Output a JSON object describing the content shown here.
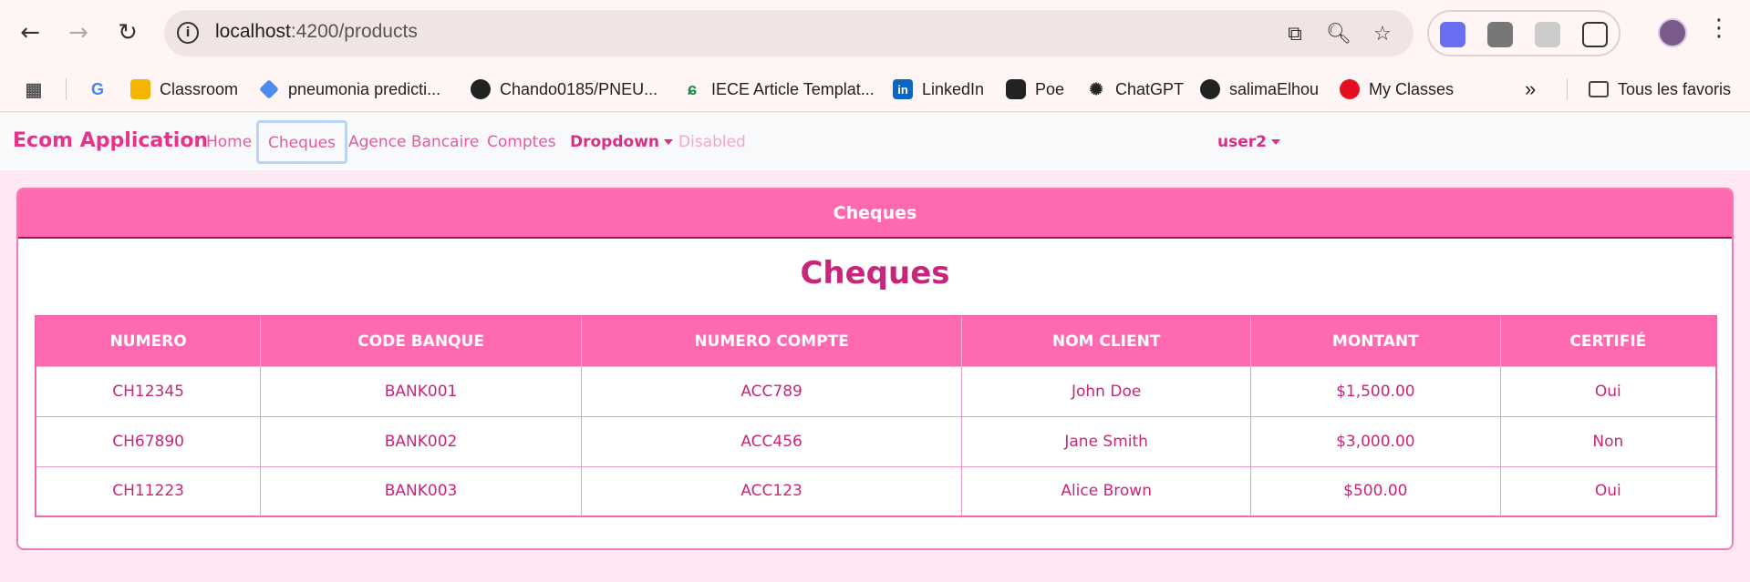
{
  "browser": {
    "url_host": "localhost",
    "url_rest": ":4200/products",
    "bookmarks": [
      {
        "label": "",
        "icon": "google-icon"
      },
      {
        "label": "Classroom",
        "icon": "classroom-icon"
      },
      {
        "label": "pneumonia predicti...",
        "icon": "layers-icon"
      },
      {
        "label": "Chando0185/PNEU...",
        "icon": "github-icon"
      },
      {
        "label": "IECE Article Templat...",
        "icon": "leaf-icon"
      },
      {
        "label": "LinkedIn",
        "icon": "linkedin-icon"
      },
      {
        "label": "Poe",
        "icon": "poe-icon"
      },
      {
        "label": "ChatGPT",
        "icon": "chatgpt-icon"
      },
      {
        "label": "salimaElhou",
        "icon": "github-icon"
      },
      {
        "label": "My Classes",
        "icon": "huawei-icon"
      }
    ],
    "all_bookmarks": "Tous les favoris"
  },
  "appnav": {
    "brand": "Ecom Application",
    "links": {
      "home": "Home",
      "cheques": "Cheques",
      "agence": "Agence Bancaire",
      "comptes": "Comptes",
      "dropdown": "Dropdown",
      "disabled": "Disabled"
    },
    "user": "user2"
  },
  "card": {
    "header": "Cheques",
    "title": "Cheques",
    "columns": [
      "NUMERO",
      "CODE BANQUE",
      "NUMERO COMPTE",
      "NOM CLIENT",
      "MONTANT",
      "CERTIFIÉ"
    ],
    "rows": [
      [
        "CH12345",
        "BANK001",
        "ACC789",
        "John Doe",
        "$1,500.00",
        "Oui"
      ],
      [
        "CH67890",
        "BANK002",
        "ACC456",
        "Jane Smith",
        "$3,000.00",
        "Non"
      ],
      [
        "CH11223",
        "BANK003",
        "ACC123",
        "Alice Brown",
        "$500.00",
        "Oui"
      ]
    ]
  },
  "colors": {
    "brand": "#e8318a",
    "header_pink": "#ff69b0",
    "text_pink": "#c8267a",
    "page_bg": "#fde8f3"
  }
}
